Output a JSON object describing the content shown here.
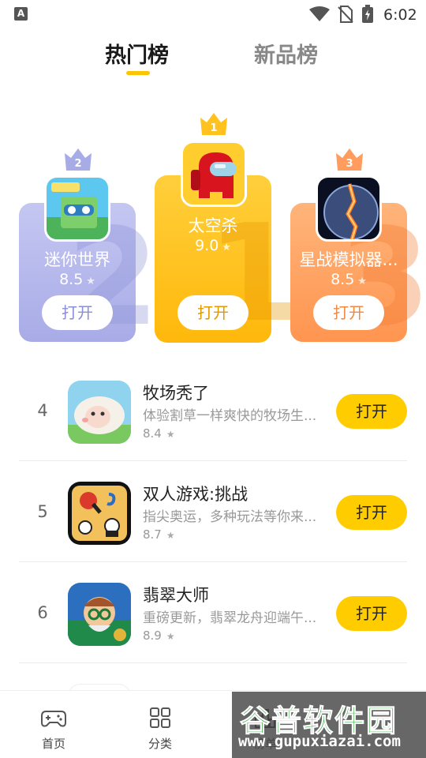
{
  "status_bar": {
    "app_indicator": "A",
    "time": "6:02",
    "icons": [
      "wifi-icon",
      "no-sim-icon",
      "battery-charging-icon"
    ]
  },
  "tabs": [
    {
      "label": "热门榜",
      "active": true
    },
    {
      "label": "新品榜",
      "active": false
    }
  ],
  "podium": [
    {
      "rank": "1",
      "name": "太空杀",
      "rating": "9.0",
      "button": "打开",
      "icon": "among-us-icon",
      "color": "#ffc21f"
    },
    {
      "rank": "2",
      "name": "迷你世界",
      "rating": "8.5",
      "button": "打开",
      "icon": "mini-world-icon",
      "color": "#b5b8ec"
    },
    {
      "rank": "3",
      "name": "星战模拟器...",
      "rating": "8.5",
      "button": "打开",
      "icon": "star-wars-sim-icon",
      "color": "#ffa066"
    }
  ],
  "list": [
    {
      "rank": "4",
      "title": "牧场秃了",
      "desc": "体验割草一样爽快的牧场生...",
      "score": "8.4",
      "button": "打开",
      "icon": "sheep-icon"
    },
    {
      "rank": "5",
      "title": "双人游戏:挑战",
      "desc": "指尖奥运，多种玩法等你来...",
      "score": "8.7",
      "button": "打开",
      "icon": "two-player-icon"
    },
    {
      "rank": "6",
      "title": "翡翠大师",
      "desc": "重磅更新，翡翠龙舟迎端午...",
      "score": "8.9",
      "button": "打开",
      "icon": "jade-master-icon"
    },
    {
      "rank": "",
      "title": "",
      "desc": "",
      "score": "",
      "button": "",
      "icon": "partial-row-icon"
    }
  ],
  "bottom_nav": [
    {
      "label": "首页",
      "icon": "gamepad-icon"
    },
    {
      "label": "分类",
      "icon": "grid-icon"
    },
    {
      "label": "榜单",
      "icon": "ranking-icon"
    }
  ],
  "watermark": {
    "cn": "谷普软件园",
    "url": "www.gupuxiazai.com"
  },
  "colors": {
    "accent": "#ffcc00",
    "tab_indicator": "#ffc400",
    "text_primary": "#222222",
    "text_secondary": "#999999"
  }
}
